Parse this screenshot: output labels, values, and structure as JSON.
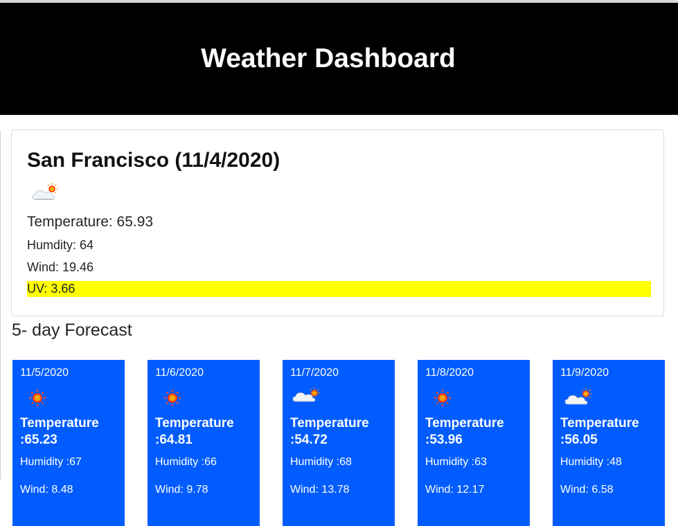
{
  "header": {
    "title": "Weather Dashboard"
  },
  "current": {
    "city_title": "San Francisco (11/4/2020)",
    "icon": "cloud-sun-icon",
    "temperature": "Temperature: 65.93",
    "humidity": "Humdity: 64",
    "wind": "Wind: 19.46",
    "uv": "UV: 3.66",
    "uv_color": "#ffff00"
  },
  "forecast": {
    "title": "5- day Forecast",
    "card_color": "#005cff",
    "days": [
      {
        "date": "11/5/2020",
        "icon": "sun-icon",
        "temp_label": "Temperature",
        "temp_value": ":65.23",
        "humidity": "Humidity :67",
        "wind": "Wind: 8.48"
      },
      {
        "date": "11/6/2020",
        "icon": "sun-icon",
        "temp_label": "Temperature",
        "temp_value": ":64.81",
        "humidity": "Humidity :66",
        "wind": "Wind: 9.78"
      },
      {
        "date": "11/7/2020",
        "icon": "rain-cloud-sun-icon",
        "temp_label": "Temperature",
        "temp_value": ":54.72",
        "humidity": "Humidity :68",
        "wind": "Wind: 13.78"
      },
      {
        "date": "11/8/2020",
        "icon": "sun-icon",
        "temp_label": "Temperature",
        "temp_value": ":53.96",
        "humidity": "Humidity :63",
        "wind": "Wind: 12.17"
      },
      {
        "date": "11/9/2020",
        "icon": "cloud-sun-icon",
        "temp_label": "Temperature",
        "temp_value": ":56.05",
        "humidity": "Humidity :48",
        "wind": "Wind: 6.58"
      }
    ]
  }
}
